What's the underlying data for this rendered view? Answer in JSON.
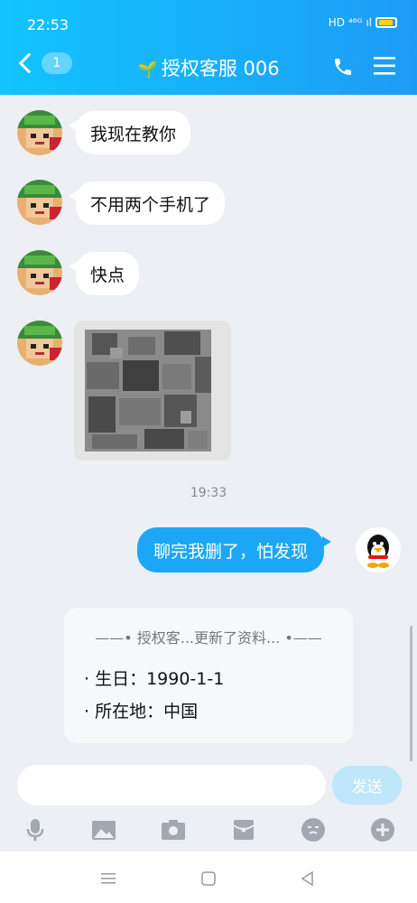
{
  "status": {
    "time": "22:53",
    "network": "HD ⁴⁶ᴳ",
    "signal": "ıl"
  },
  "header": {
    "back_badge": "1",
    "title": "授权客服 006",
    "leaf_icon": "sprout-icon"
  },
  "messages": [
    {
      "from": "other",
      "text": "我现在教你"
    },
    {
      "from": "other",
      "text": "不用两个手机了"
    },
    {
      "from": "other",
      "text": "快点"
    }
  ],
  "timestamp": "19:33",
  "my_message": "聊完我删了，怕发现",
  "profile_card": {
    "header": "——• 授权客...更新了资料... •——",
    "birthday": "· 生日：1990-1-1",
    "location": "· 所在地：中国"
  },
  "input": {
    "placeholder": ""
  },
  "send_label": "发送",
  "colors": {
    "header": "#1ba7f5",
    "bubble_self": "#1ba7f5",
    "background": "#eceff4"
  }
}
